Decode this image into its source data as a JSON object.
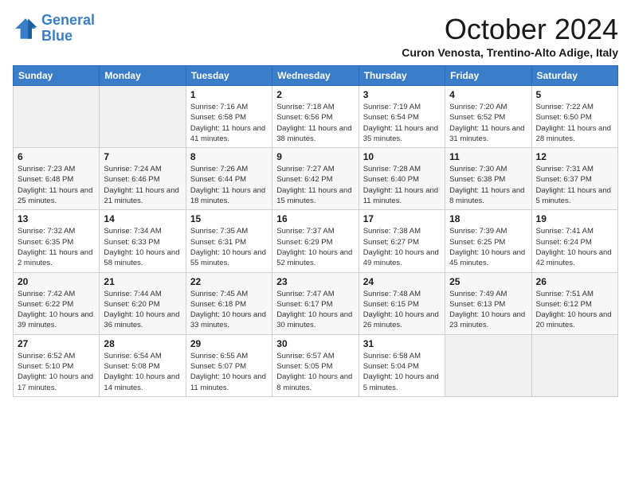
{
  "header": {
    "logo_line1": "General",
    "logo_line2": "Blue",
    "month_title": "October 2024",
    "location": "Curon Venosta, Trentino-Alto Adige, Italy"
  },
  "days_of_week": [
    "Sunday",
    "Monday",
    "Tuesday",
    "Wednesday",
    "Thursday",
    "Friday",
    "Saturday"
  ],
  "weeks": [
    [
      {
        "day": "",
        "info": ""
      },
      {
        "day": "",
        "info": ""
      },
      {
        "day": "1",
        "info": "Sunrise: 7:16 AM\nSunset: 6:58 PM\nDaylight: 11 hours and 41 minutes."
      },
      {
        "day": "2",
        "info": "Sunrise: 7:18 AM\nSunset: 6:56 PM\nDaylight: 11 hours and 38 minutes."
      },
      {
        "day": "3",
        "info": "Sunrise: 7:19 AM\nSunset: 6:54 PM\nDaylight: 11 hours and 35 minutes."
      },
      {
        "day": "4",
        "info": "Sunrise: 7:20 AM\nSunset: 6:52 PM\nDaylight: 11 hours and 31 minutes."
      },
      {
        "day": "5",
        "info": "Sunrise: 7:22 AM\nSunset: 6:50 PM\nDaylight: 11 hours and 28 minutes."
      }
    ],
    [
      {
        "day": "6",
        "info": "Sunrise: 7:23 AM\nSunset: 6:48 PM\nDaylight: 11 hours and 25 minutes."
      },
      {
        "day": "7",
        "info": "Sunrise: 7:24 AM\nSunset: 6:46 PM\nDaylight: 11 hours and 21 minutes."
      },
      {
        "day": "8",
        "info": "Sunrise: 7:26 AM\nSunset: 6:44 PM\nDaylight: 11 hours and 18 minutes."
      },
      {
        "day": "9",
        "info": "Sunrise: 7:27 AM\nSunset: 6:42 PM\nDaylight: 11 hours and 15 minutes."
      },
      {
        "day": "10",
        "info": "Sunrise: 7:28 AM\nSunset: 6:40 PM\nDaylight: 11 hours and 11 minutes."
      },
      {
        "day": "11",
        "info": "Sunrise: 7:30 AM\nSunset: 6:38 PM\nDaylight: 11 hours and 8 minutes."
      },
      {
        "day": "12",
        "info": "Sunrise: 7:31 AM\nSunset: 6:37 PM\nDaylight: 11 hours and 5 minutes."
      }
    ],
    [
      {
        "day": "13",
        "info": "Sunrise: 7:32 AM\nSunset: 6:35 PM\nDaylight: 11 hours and 2 minutes."
      },
      {
        "day": "14",
        "info": "Sunrise: 7:34 AM\nSunset: 6:33 PM\nDaylight: 10 hours and 58 minutes."
      },
      {
        "day": "15",
        "info": "Sunrise: 7:35 AM\nSunset: 6:31 PM\nDaylight: 10 hours and 55 minutes."
      },
      {
        "day": "16",
        "info": "Sunrise: 7:37 AM\nSunset: 6:29 PM\nDaylight: 10 hours and 52 minutes."
      },
      {
        "day": "17",
        "info": "Sunrise: 7:38 AM\nSunset: 6:27 PM\nDaylight: 10 hours and 49 minutes."
      },
      {
        "day": "18",
        "info": "Sunrise: 7:39 AM\nSunset: 6:25 PM\nDaylight: 10 hours and 45 minutes."
      },
      {
        "day": "19",
        "info": "Sunrise: 7:41 AM\nSunset: 6:24 PM\nDaylight: 10 hours and 42 minutes."
      }
    ],
    [
      {
        "day": "20",
        "info": "Sunrise: 7:42 AM\nSunset: 6:22 PM\nDaylight: 10 hours and 39 minutes."
      },
      {
        "day": "21",
        "info": "Sunrise: 7:44 AM\nSunset: 6:20 PM\nDaylight: 10 hours and 36 minutes."
      },
      {
        "day": "22",
        "info": "Sunrise: 7:45 AM\nSunset: 6:18 PM\nDaylight: 10 hours and 33 minutes."
      },
      {
        "day": "23",
        "info": "Sunrise: 7:47 AM\nSunset: 6:17 PM\nDaylight: 10 hours and 30 minutes."
      },
      {
        "day": "24",
        "info": "Sunrise: 7:48 AM\nSunset: 6:15 PM\nDaylight: 10 hours and 26 minutes."
      },
      {
        "day": "25",
        "info": "Sunrise: 7:49 AM\nSunset: 6:13 PM\nDaylight: 10 hours and 23 minutes."
      },
      {
        "day": "26",
        "info": "Sunrise: 7:51 AM\nSunset: 6:12 PM\nDaylight: 10 hours and 20 minutes."
      }
    ],
    [
      {
        "day": "27",
        "info": "Sunrise: 6:52 AM\nSunset: 5:10 PM\nDaylight: 10 hours and 17 minutes."
      },
      {
        "day": "28",
        "info": "Sunrise: 6:54 AM\nSunset: 5:08 PM\nDaylight: 10 hours and 14 minutes."
      },
      {
        "day": "29",
        "info": "Sunrise: 6:55 AM\nSunset: 5:07 PM\nDaylight: 10 hours and 11 minutes."
      },
      {
        "day": "30",
        "info": "Sunrise: 6:57 AM\nSunset: 5:05 PM\nDaylight: 10 hours and 8 minutes."
      },
      {
        "day": "31",
        "info": "Sunrise: 6:58 AM\nSunset: 5:04 PM\nDaylight: 10 hours and 5 minutes."
      },
      {
        "day": "",
        "info": ""
      },
      {
        "day": "",
        "info": ""
      }
    ]
  ]
}
